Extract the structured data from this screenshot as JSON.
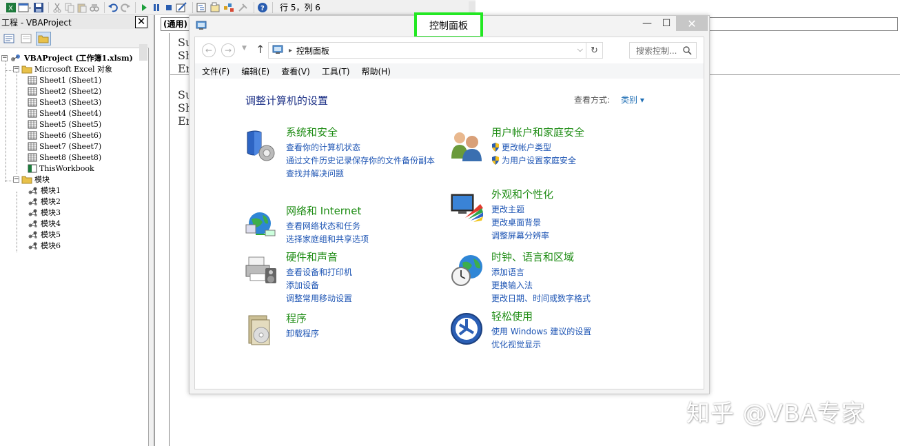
{
  "vbe_toolbar": {
    "cursor_position": "行 5，列 6"
  },
  "project_explorer": {
    "title": "工程 - VBAProject",
    "close_label": "✕",
    "tree": {
      "root": "VBAProject (工作簿1.xlsm)",
      "excel_objects_folder": "Microsoft Excel 对象",
      "sheets": [
        "Sheet1 (Sheet1)",
        "Sheet2 (Sheet2)",
        "Sheet3 (Sheet3)",
        "Sheet4 (Sheet4)",
        "Sheet5 (Sheet5)",
        "Sheet6 (Sheet6)",
        "Sheet7 (Sheet7)",
        "Sheet8 (Sheet8)"
      ],
      "workbook": "ThisWorkbook",
      "modules_folder": "模块",
      "modules": [
        "模块1",
        "模块2",
        "模块3",
        "模块4",
        "模块5",
        "模块6"
      ]
    }
  },
  "code_window": {
    "object_combo": "(通用)",
    "visible_lines": [
      "Su",
      "Sh",
      "En",
      "Su",
      "Sh",
      "En"
    ]
  },
  "control_panel": {
    "window_title": "控制面板",
    "window_buttons": {
      "minimize": "—",
      "maximize": "☐",
      "close": "✕"
    },
    "address": {
      "path": "控制面板"
    },
    "search_placeholder": "搜索控制...",
    "menu": [
      "文件(F)",
      "编辑(E)",
      "查看(V)",
      "工具(T)",
      "帮助(H)"
    ],
    "heading": "调整计算机的设置",
    "view_by": {
      "label": "查看方式:",
      "value": "类别 ▾"
    },
    "categories_left": [
      {
        "icon": "shield-security-icon",
        "title": "系统和安全",
        "links": [
          "查看你的计算机状态",
          "通过文件历史记录保存你的文件备份副本",
          "查找并解决问题"
        ]
      },
      {
        "icon": "network-globe-icon",
        "title": "网络和 Internet",
        "links": [
          "查看网络状态和任务",
          "选择家庭组和共享选项"
        ]
      },
      {
        "icon": "printer-icon",
        "title": "硬件和声音",
        "links": [
          "查看设备和打印机",
          "添加设备",
          "调整常用移动设置"
        ]
      },
      {
        "icon": "programs-disc-icon",
        "title": "程序",
        "links": [
          "卸载程序"
        ]
      }
    ],
    "categories_right": [
      {
        "icon": "users-icon",
        "title": "用户帐户和家庭安全",
        "links": [
          "更改帐户类型",
          "为用户设置家庭安全"
        ]
      },
      {
        "icon": "monitor-palette-icon",
        "title": "外观和个性化",
        "links": [
          "更改主题",
          "更改桌面背景",
          "调整屏幕分辨率"
        ]
      },
      {
        "icon": "clock-globe-icon",
        "title": "时钟、语言和区域",
        "links": [
          "添加语言",
          "更换输入法",
          "更改日期、时间或数字格式"
        ]
      },
      {
        "icon": "ease-of-access-icon",
        "title": "轻松使用",
        "links": [
          "使用 Windows 建议的设置",
          "优化视觉显示"
        ]
      }
    ]
  },
  "watermark": "知乎 @VBA专家"
}
